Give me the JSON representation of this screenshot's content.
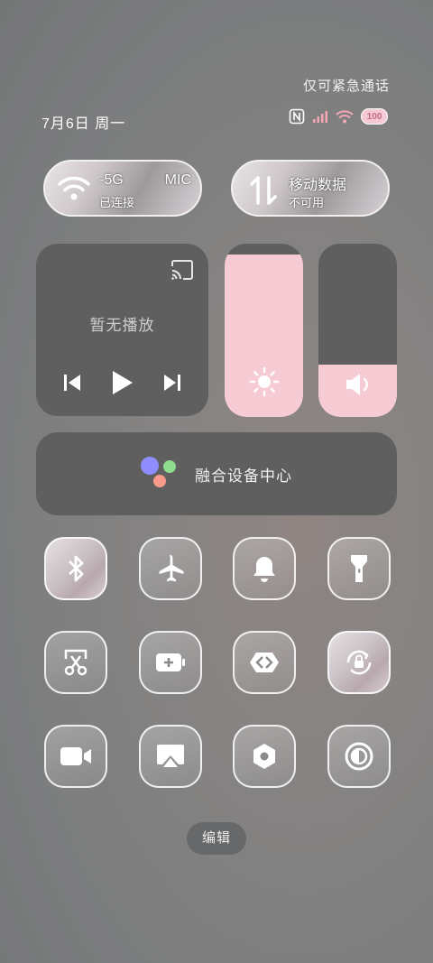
{
  "status_bar": {
    "emergency_text": "仅可紧急通话",
    "date": "7月6日 周一",
    "battery": "100"
  },
  "connectivity": {
    "wifi": {
      "name_left": "-5G",
      "name_right": "MIC",
      "status": "已连接"
    },
    "mobile_data": {
      "label": "移动数据",
      "status": "不可用"
    }
  },
  "media": {
    "now_playing": "暂无播放"
  },
  "sliders": {
    "brightness_level": 0.94,
    "volume_level": 0.3
  },
  "fusion": {
    "label": "融合设备中心"
  },
  "tiles": [
    {
      "icon": "bluetooth-icon",
      "active": true
    },
    {
      "icon": "airplane-icon",
      "active": false
    },
    {
      "icon": "bell-icon",
      "active": false
    },
    {
      "icon": "flashlight-icon",
      "active": false
    },
    {
      "icon": "screenshot-scissors-icon",
      "active": false
    },
    {
      "icon": "battery-saver-icon",
      "active": false
    },
    {
      "icon": "vpn-icon",
      "active": false
    },
    {
      "icon": "rotation-lock-icon",
      "active": true
    },
    {
      "icon": "video-icon",
      "active": false
    },
    {
      "icon": "screen-cast-icon",
      "active": false
    },
    {
      "icon": "settings-hex-icon",
      "active": false
    },
    {
      "icon": "dark-mode-icon",
      "active": false
    }
  ],
  "edit_label": "编辑",
  "colors": {
    "accent_pink": "#f7cbd4",
    "panel_gray": "#5f5f60"
  }
}
